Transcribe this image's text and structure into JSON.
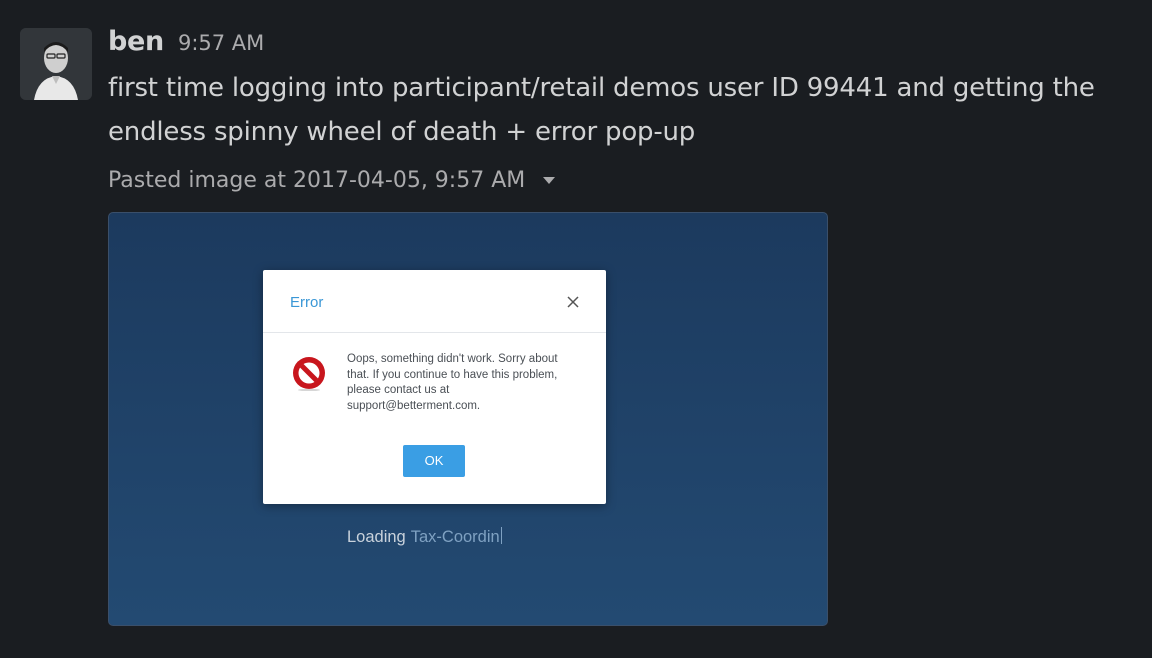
{
  "message": {
    "sender": "ben",
    "timestamp": "9:57 AM",
    "text": "first time logging into participant/retail demos user ID 99441 and getting the endless spinny wheel of death + error pop-up",
    "attachment_label": "Pasted image at 2017-04-05, 9:57 AM",
    "avatar_icon": "user-avatar-photo",
    "caret_icon": "chevron-down-icon"
  },
  "screenshot": {
    "modal": {
      "title": "Error",
      "close_icon": "close-icon",
      "error_icon": "no-entry-icon",
      "message": "Oops, something didn't work. Sorry about that. If you continue to have this problem, please contact us at support@betterment.com.",
      "ok_label": "OK"
    },
    "loading_prefix": "Loading",
    "loading_item": "Tax-Coordin"
  },
  "colors": {
    "background": "#1a1d21",
    "text": "#d1d2d3",
    "muted": "#ababad",
    "modal_accent": "#3a97d6",
    "button": "#3a9ee4",
    "error_red": "#c8161d"
  }
}
